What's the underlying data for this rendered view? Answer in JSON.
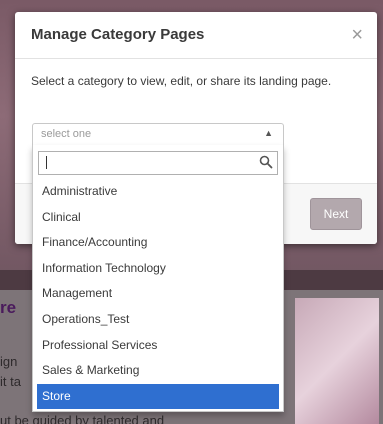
{
  "background": {
    "heading_fragment": "re",
    "line1": "ign",
    "line2": "it ta",
    "line3": "ut be guided by talented and"
  },
  "modal": {
    "title": "Manage Category Pages",
    "close_symbol": "×",
    "description": "Select a category to view, edit, or share its landing page.",
    "cancel_partial": "el",
    "next_label": "Next"
  },
  "select": {
    "current_value": "select one",
    "arrow": "▲",
    "search_placeholder": "",
    "options": [
      {
        "label": "Administrative",
        "selected": false
      },
      {
        "label": "Clinical",
        "selected": false
      },
      {
        "label": "Finance/Accounting",
        "selected": false
      },
      {
        "label": "Information Technology",
        "selected": false
      },
      {
        "label": "Management",
        "selected": false
      },
      {
        "label": "Operations_Test",
        "selected": false
      },
      {
        "label": "Professional Services",
        "selected": false
      },
      {
        "label": "Sales & Marketing",
        "selected": false
      },
      {
        "label": "Store",
        "selected": true
      }
    ]
  },
  "colors": {
    "highlight": "#2f6fd0",
    "next_button": "#b3a8ad"
  }
}
